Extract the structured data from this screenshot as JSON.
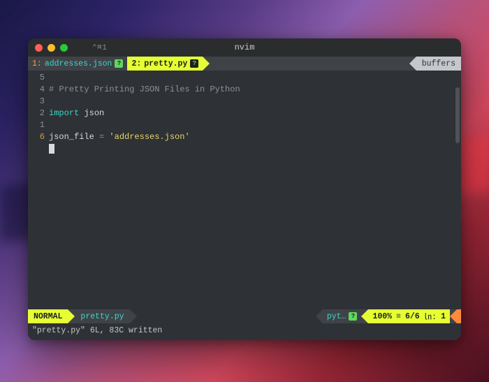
{
  "window": {
    "shell_tab": "⌃⌘1",
    "title": "nvim"
  },
  "tabline": {
    "buffers": [
      {
        "number": "1:",
        "name": "addresses.json",
        "active": false,
        "modified_icon": "?"
      },
      {
        "number": "2:",
        "name": "pretty.py",
        "active": true,
        "modified_icon": "?"
      }
    ],
    "right_label": "buffers"
  },
  "editor": {
    "gutter": [
      "5",
      "4",
      "3",
      "2",
      "1",
      "6"
    ],
    "lines": [
      {
        "type": "comment",
        "text": "# Pretty Printing JSON Files in Python"
      },
      {
        "type": "blank",
        "text": ""
      },
      {
        "type": "import",
        "kw": "import",
        "mod": "json"
      },
      {
        "type": "blank",
        "text": ""
      },
      {
        "type": "assign",
        "var": "json_file",
        "op": " = ",
        "val": "'addresses.json'"
      },
      {
        "type": "cursor",
        "text": ""
      }
    ]
  },
  "status": {
    "mode": "NORMAL",
    "filename": "pretty.py",
    "filetype": "pyt…",
    "filetype_icon": "?",
    "percent": "100%",
    "sep1": "≡",
    "linecol": "6/6",
    "sep2": "㏑:",
    "col": "1"
  },
  "message": "\"pretty.py\" 6L, 83C written"
}
